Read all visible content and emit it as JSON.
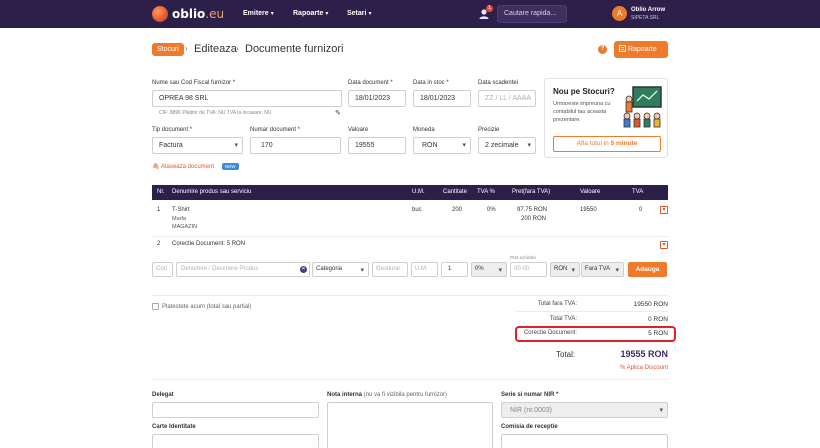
{
  "brand": {
    "name": "oblio",
    "tld": ".eu"
  },
  "nav": {
    "items": [
      "Emitere",
      "Rapoarte",
      "Setari"
    ]
  },
  "notifications": {
    "count": "1"
  },
  "search": {
    "placeholder": "Cautare rapida..."
  },
  "user": {
    "name": "Oblio Arrow",
    "company": "SIPETA SRL",
    "initial": "A"
  },
  "breadcrumb": {
    "root": "Stocuri",
    "step": "Editeaza",
    "page": "Documente furnizori"
  },
  "help_label": "?",
  "report_button": "Rapoarte",
  "form": {
    "supplier_label": "Nume sau Cod Fiscal furnizor *",
    "supplier_value": "OPREA 98 SRL",
    "supplier_note": "CIF: 8896   Platitor de TVA: NU   TVA la incasare: NU",
    "doc_date_label": "Data document *",
    "doc_date_value": "18/01/2023",
    "stock_date_label": "Data in stoc *",
    "stock_date_value": "18/01/2023",
    "due_date_label": "Data scadentei",
    "due_date_placeholder": "ZZ / LL / AAAA",
    "doc_type_label": "Tip document *",
    "doc_type_value": "Factura",
    "doc_number_label": "Numar document *",
    "doc_number_value": "170",
    "value_label": "Valoare",
    "value_value": "19555",
    "currency_label": "Moneda",
    "currency_value": "RON",
    "precision_label": "Precizie",
    "precision_value": "2 zecimale",
    "attach_label": "Ataseaza document",
    "new_badge": "NEW"
  },
  "promo": {
    "title": "Nou pe Stocuri?",
    "text": "Urmareste impreuna cu contabilul tau aceasta prezentare.",
    "button_prefix": "Afla totul in ",
    "button_bold": "5 minute"
  },
  "table": {
    "headers": [
      "Nr.",
      "Denumire produs sau serviciu",
      "U.M.",
      "Cantitate",
      "TVA %",
      "Pret(fara TVA)",
      "Valoare",
      "TVA"
    ],
    "row1": {
      "nr": "1",
      "name": "T-Shirt",
      "sub1": "Marfa",
      "sub2": "MAGAZIN",
      "um": "buc",
      "qty": "200",
      "vat_pct": "0%",
      "price": "97.75 RON",
      "price2": "200 RON",
      "value": "19550",
      "vat": "0"
    },
    "row2": {
      "nr": "2",
      "name": "Corectie Document: 5 RON"
    }
  },
  "entry": {
    "code_ph": "Cod",
    "name_ph": "Denumire / Descriere Produs",
    "category": "Categoria",
    "management_ph": "Gestiune",
    "um_ph": "U.M.",
    "qty": "1",
    "vat": "0%",
    "price_note": "Pret achizitie",
    "price_ph": "00.00",
    "currency": "RON",
    "vat_mode": "Fara TVA",
    "add_button": "Adauga"
  },
  "payment": {
    "paid_now_label": "Platestete acum (total sau partial)"
  },
  "totals": {
    "without_vat_label": "Total fara TVA:",
    "without_vat_value": "19550 RON",
    "vat_label": "Total TVA:",
    "vat_value": "0 RON",
    "correction_label": "Corectie Document:",
    "correction_value": "5 RON",
    "total_label": "Total:",
    "total_value": "19555 RON",
    "discount_label": "% Aplica Discount"
  },
  "bottom": {
    "delegate_label": "Delegat",
    "internal_note_label": "Nota interna",
    "internal_note_hint": "(nu va fi vizibila pentru furnizor)",
    "series_label": "Serie si numar NIR *",
    "series_value": "NIR (nr.0003)",
    "id_card_label": "Carte Identitate",
    "commission_label": "Comisia de receptie"
  }
}
